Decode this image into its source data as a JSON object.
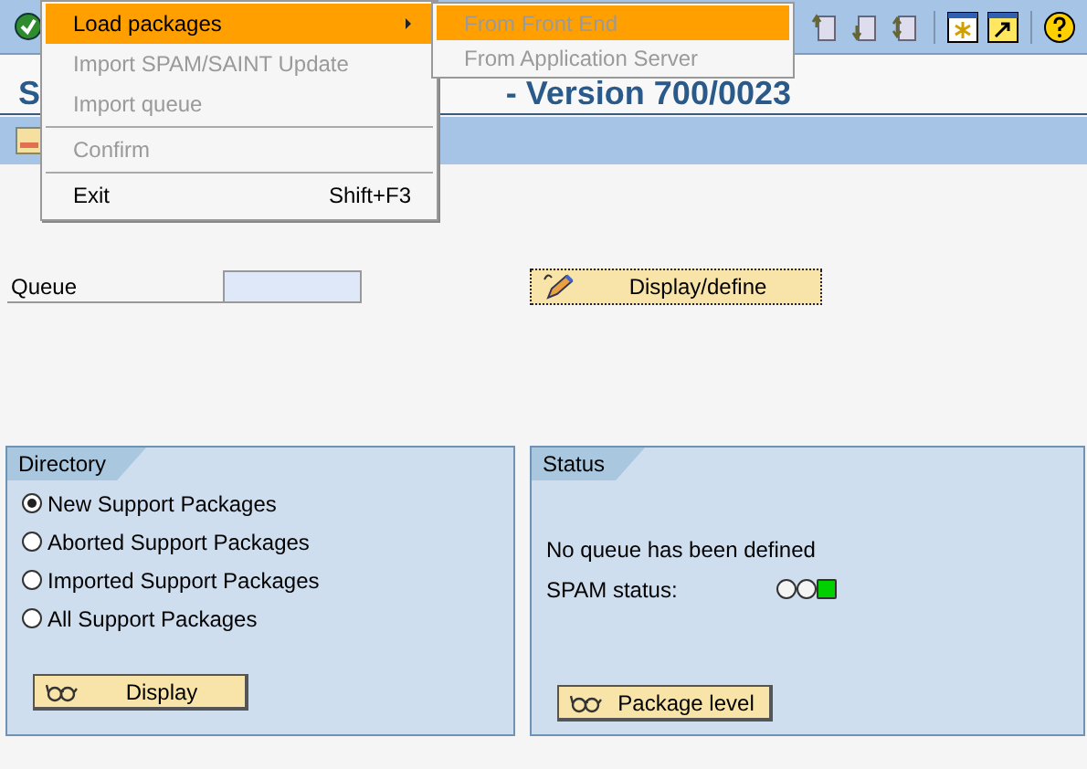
{
  "title": {
    "visible_start": "S",
    "visible_end": "- Version 700/0023"
  },
  "menu": [
    {
      "label": "Load packages",
      "selected": true,
      "disabled": false,
      "submenu": true
    },
    {
      "label": "Import SPAM/SAINT Update",
      "selected": false,
      "disabled": true,
      "separator_after": false
    },
    {
      "label": "Import queue",
      "selected": false,
      "disabled": true,
      "separator_after": true
    },
    {
      "label": "Confirm",
      "selected": false,
      "disabled": true,
      "separator_after": true
    },
    {
      "label": "Exit",
      "selected": false,
      "disabled": false,
      "shortcut": "Shift+F3"
    }
  ],
  "submenu": [
    {
      "label": "From Front End",
      "selected": true,
      "disabled": true
    },
    {
      "label": "From Application Server",
      "selected": false,
      "disabled": true
    }
  ],
  "queue": {
    "label": "Queue",
    "button": "Display/define"
  },
  "directory": {
    "title": "Directory",
    "options": [
      {
        "label": "New Support Packages",
        "selected": true
      },
      {
        "label": "Aborted Support Packages",
        "selected": false
      },
      {
        "label": "Imported Support Packages",
        "selected": false
      },
      {
        "label": "All Support Packages",
        "selected": false
      }
    ],
    "button": "Display"
  },
  "status": {
    "title": "Status",
    "message": "No queue has been defined",
    "label": "SPAM status:",
    "lights": [
      {
        "color": "#f4f4f4"
      },
      {
        "color": "#f4f4f4"
      },
      {
        "color": "#00d000"
      }
    ],
    "button": "Package level"
  }
}
